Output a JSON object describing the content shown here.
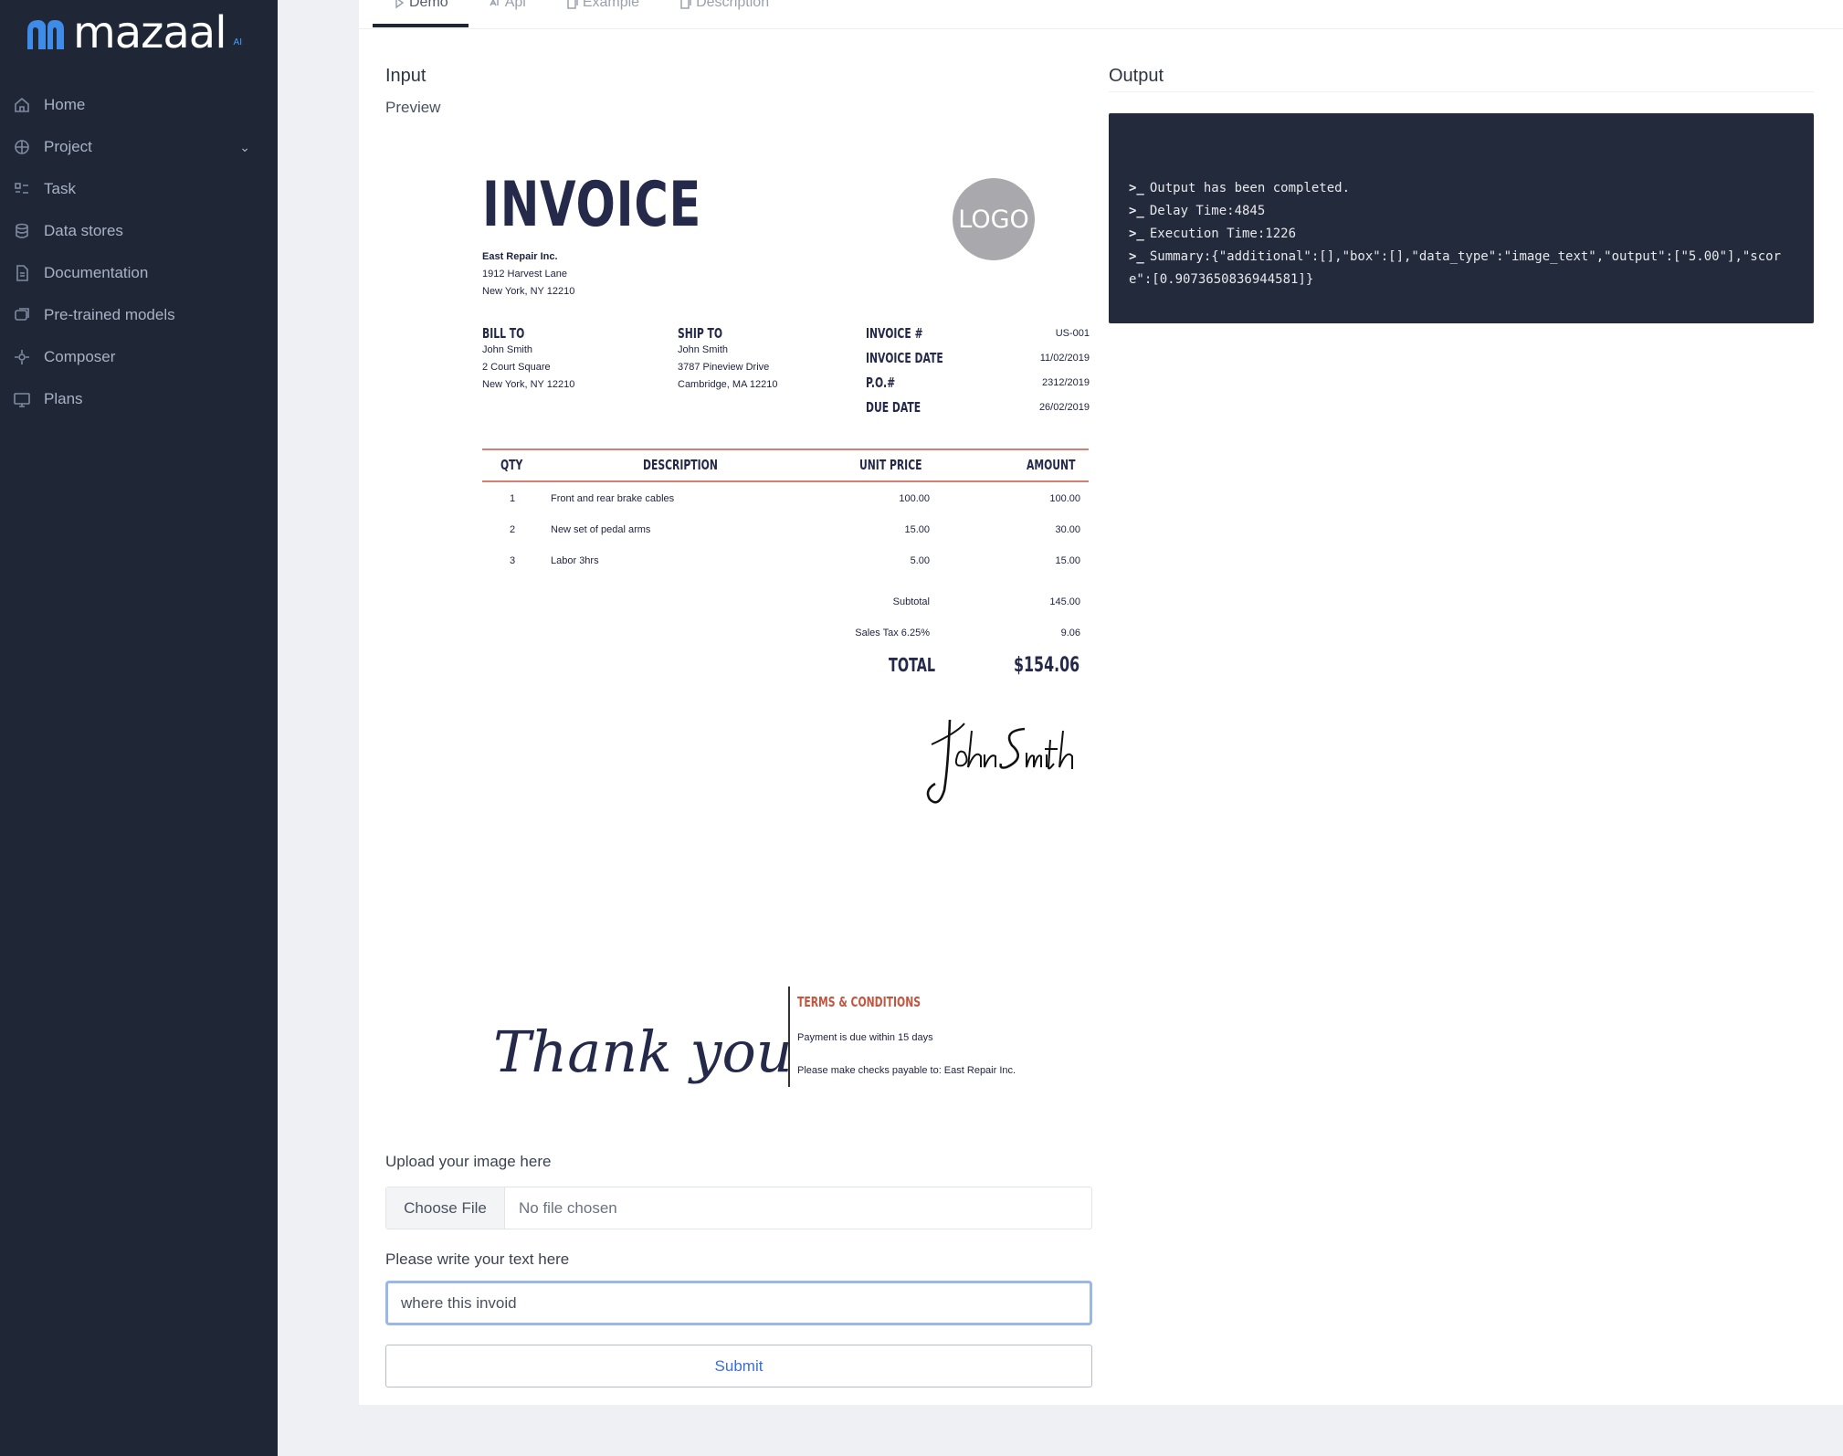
{
  "brand": {
    "name": "mazaal",
    "suffix": "AI"
  },
  "sidebar": {
    "items": [
      {
        "label": "Home",
        "icon": "home-icon"
      },
      {
        "label": "Project",
        "icon": "project-icon",
        "has_chevron": true
      },
      {
        "label": "Task",
        "icon": "task-icon"
      },
      {
        "label": "Data stores",
        "icon": "database-icon"
      },
      {
        "label": "Documentation",
        "icon": "document-icon"
      },
      {
        "label": "Pre-trained models",
        "icon": "models-icon"
      },
      {
        "label": "Composer",
        "icon": "composer-icon"
      },
      {
        "label": "Plans",
        "icon": "plans-icon"
      }
    ]
  },
  "tabs": [
    {
      "label": "Demo",
      "active": true
    },
    {
      "label": "Api",
      "active": false
    },
    {
      "label": "Example",
      "active": false
    },
    {
      "label": "Description",
      "active": false
    }
  ],
  "input": {
    "title": "Input",
    "preview_label": "Preview"
  },
  "output": {
    "title": "Output",
    "lines": [
      "Output has been completed.",
      "Delay Time:4845",
      "Execution Time:1226",
      "Summary:{\"additional\":[],\"box\":[],\"data_type\":\"image_text\",\"output\":[\"5.00\"],\"score\":[0.9073650836944581]}"
    ],
    "prompt": ">_"
  },
  "invoice": {
    "title": "INVOICE",
    "logo": "LOGO",
    "from": [
      "East Repair Inc.",
      "1912 Harvest Lane",
      "New York, NY 12210"
    ],
    "bill_to": {
      "heading": "BILL TO",
      "lines": [
        "John Smith",
        "2 Court Square",
        "New York, NY 12210"
      ]
    },
    "ship_to": {
      "heading": "SHIP TO",
      "lines": [
        "John Smith",
        "3787 Pineview Drive",
        "Cambridge, MA 12210"
      ]
    },
    "meta": [
      {
        "label": "INVOICE #",
        "value": "US-001"
      },
      {
        "label": "INVOICE DATE",
        "value": "11/02/2019"
      },
      {
        "label": "P.O.#",
        "value": "2312/2019"
      },
      {
        "label": "DUE DATE",
        "value": "26/02/2019"
      }
    ],
    "columns": [
      "QTY",
      "DESCRIPTION",
      "UNIT PRICE",
      "AMOUNT"
    ],
    "rows": [
      {
        "qty": "1",
        "desc": "Front and rear brake cables",
        "unit": "100.00",
        "amount": "100.00"
      },
      {
        "qty": "2",
        "desc": "New set of pedal arms",
        "unit": "15.00",
        "amount": "30.00"
      },
      {
        "qty": "3",
        "desc": "Labor 3hrs",
        "unit": "5.00",
        "amount": "15.00"
      }
    ],
    "subtotal": {
      "label": "Subtotal",
      "value": "145.00"
    },
    "tax": {
      "label": "Sales Tax 6.25%",
      "value": "9.06"
    },
    "total": {
      "label": "TOTAL",
      "value": "$154.06"
    },
    "thank_you": "Thank you",
    "terms": {
      "title": "TERMS & CONDITIONS",
      "lines": [
        "Payment is due within 15 days",
        "Please make checks payable to: East Repair Inc."
      ]
    }
  },
  "form": {
    "upload_label": "Upload your image here",
    "choose_file": "Choose File",
    "no_file": "No file chosen",
    "text_label": "Please write your text here",
    "text_value": "where this invoid",
    "submit": "Submit"
  }
}
